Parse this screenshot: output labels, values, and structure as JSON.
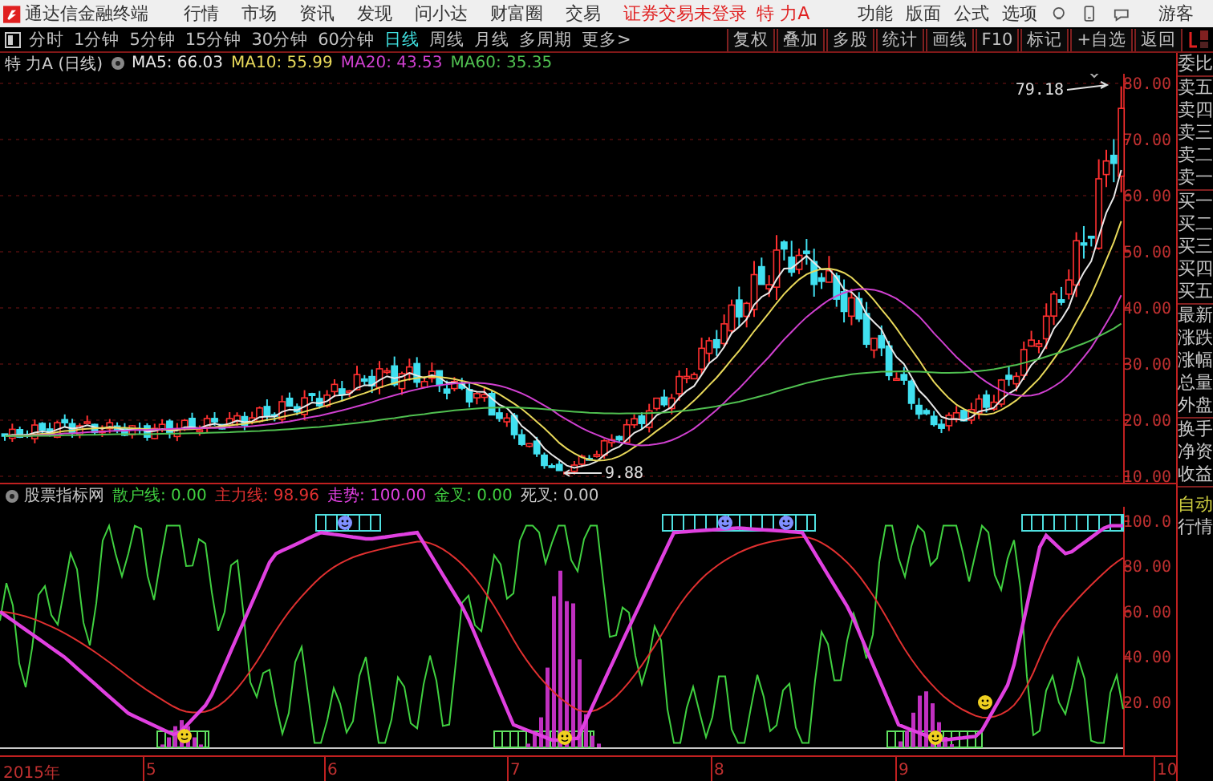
{
  "menubar": {
    "app_title": "通达信金融终端",
    "menus": [
      "行情",
      "市场",
      "资讯",
      "发现",
      "问小达",
      "财富圈",
      "交易"
    ],
    "login_status": "证券交易未登录",
    "stock": "特 力A",
    "items": [
      "功能",
      "版面",
      "公式",
      "选项"
    ],
    "user": "游客"
  },
  "periods": [
    {
      "label": "分时",
      "selected": false
    },
    {
      "label": "1分钟",
      "selected": false
    },
    {
      "label": "5分钟",
      "selected": false
    },
    {
      "label": "15分钟",
      "selected": false
    },
    {
      "label": "30分钟",
      "selected": false
    },
    {
      "label": "60分钟",
      "selected": false
    },
    {
      "label": "日线",
      "selected": true
    },
    {
      "label": "周线",
      "selected": false
    },
    {
      "label": "月线",
      "selected": false
    },
    {
      "label": "多周期",
      "selected": false
    },
    {
      "label": "更多>",
      "selected": false
    }
  ],
  "tools": [
    "复权",
    "叠加",
    "多股",
    "统计",
    "画线",
    "F10",
    "标记",
    "+自选",
    "返回"
  ],
  "quote": {
    "name": "特 力A",
    "period": "(日线)",
    "ma": [
      {
        "label": "MA5:",
        "value": "66.03",
        "color": "#e8e8e8"
      },
      {
        "label": "MA10:",
        "value": "55.99",
        "color": "#e8d85a"
      },
      {
        "label": "MA20:",
        "value": "43.53",
        "color": "#d040d0"
      },
      {
        "label": "MA60:",
        "value": "35.35",
        "color": "#50c050"
      }
    ]
  },
  "price_chart": {
    "y_ticks": [
      "80.00",
      "70.00",
      "60.00",
      "50.00",
      "40.00",
      "30.00",
      "20.00",
      "10.00"
    ],
    "high_label": "79.18",
    "low_label": "9.88"
  },
  "side_panel": {
    "groups": [
      [
        "委比"
      ],
      [
        "卖五",
        "卖四",
        "卖三",
        "卖二",
        "卖一"
      ],
      [
        "买一",
        "买二",
        "买三",
        "买四",
        "买五"
      ],
      [
        "最新",
        "涨跌",
        "涨幅",
        "总量",
        "外盘"
      ],
      [
        "换手",
        "净资",
        "收益"
      ]
    ],
    "auto": "自动",
    "quote": "行情"
  },
  "indicator": {
    "name": "股票指标网",
    "lines": [
      {
        "label": "散户线:",
        "value": "0.00",
        "color": "#40d040"
      },
      {
        "label": "主力线:",
        "value": "98.96",
        "color": "#e03030"
      },
      {
        "label": "走势:",
        "value": "100.00",
        "color": "#e040e0"
      },
      {
        "label": "金叉:",
        "value": "0.00",
        "color": "#40d040"
      },
      {
        "label": "死叉:",
        "value": "0.00",
        "color": "#c8c8c8"
      }
    ],
    "y_ticks": [
      "100.0",
      "80.00",
      "60.00",
      "40.00",
      "20.00"
    ]
  },
  "date_axis": [
    "2015年",
    "5",
    "6",
    "7",
    "8",
    "9",
    "10"
  ]
}
